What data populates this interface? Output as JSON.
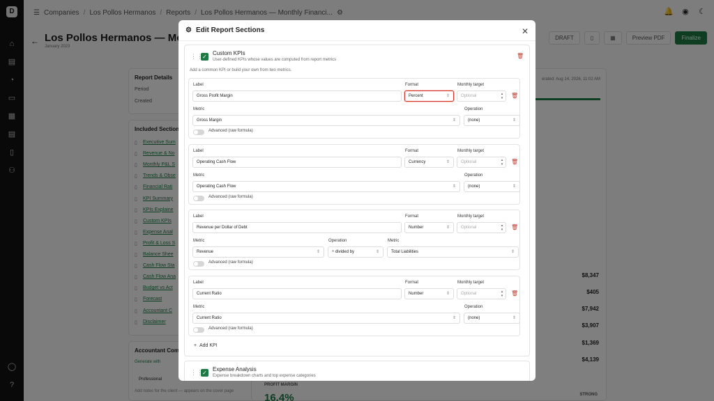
{
  "breadcrumb": {
    "items": [
      "Companies",
      "Los Pollos Hermanos",
      "Reports",
      "Los Pollos Hermanos — Monthly Financi..."
    ]
  },
  "page": {
    "title": "Los Pollos Hermanos — Month",
    "subtitle": "January 2023"
  },
  "toolbar": {
    "draft": "DRAFT",
    "preview": "Preview PDF",
    "finalize": "Finalize"
  },
  "details": {
    "heading": "Report Details",
    "period": "Period",
    "created": "Created"
  },
  "included": {
    "heading": "Included Section",
    "items": [
      "Executive Sum",
      "Revenue & No",
      "Monthly P&L S",
      "Trends & Obse",
      "Financial Rati",
      "KPI Summary",
      "KPIs Explaine",
      "Custom KPIs",
      "Expense Anal",
      "Profit & Loss S",
      "Balance Shee",
      "Cash Flow Sta",
      "Cash Flow Ana",
      "Budget vs Act",
      "Forecast",
      "Accountant C",
      "Disclaimer"
    ]
  },
  "accountant": {
    "heading": "Accountant Com",
    "generate": "Generate with",
    "tab": "Professional",
    "note": "Add notes for the client — appears on the cover page"
  },
  "right": {
    "generated": "erated: Aug 14, 2026, 11:02 AM",
    "values": [
      "$8,347",
      "$405",
      "$7,942",
      "$3,907",
      "$1,369",
      "$4,139"
    ],
    "profit_label": "PROFIT MARGIN",
    "profit_value": "16.4%",
    "strong": "STRONG"
  },
  "modal": {
    "title": "Edit Report Sections",
    "custom": {
      "title": "Custom KPIs",
      "desc": "User-defined KPIs whose values are computed from report metrics",
      "hint": "Add a common KPI or build your own from two metrics."
    },
    "labels": {
      "label": "Label",
      "format": "Format",
      "target": "Monthly target",
      "metric": "Metric",
      "operation": "Operation",
      "advanced": "Advanced (raw formula)",
      "placeholder": "Optional"
    },
    "kpis": [
      {
        "label": "Gross Profit Margin",
        "format": "Percent",
        "metric": "Gross Margin",
        "operation": "(none)"
      },
      {
        "label": "Operating Cash Flow",
        "format": "Currency",
        "metric": "Operating Cash Flow",
        "operation": "(none)"
      },
      {
        "label": "Revenue per Dollar of Debt",
        "format": "Number",
        "metric": "Revenue",
        "operation": "÷ divided by",
        "metric2": "Total Liabilities"
      },
      {
        "label": "Current Ratio",
        "format": "Number",
        "metric": "Current Ratio",
        "operation": "(none)"
      }
    ],
    "add_kpi": "Add KPI",
    "expense": {
      "title": "Expense Analysis",
      "desc": "Expense breakdown charts and top expense categories"
    }
  }
}
